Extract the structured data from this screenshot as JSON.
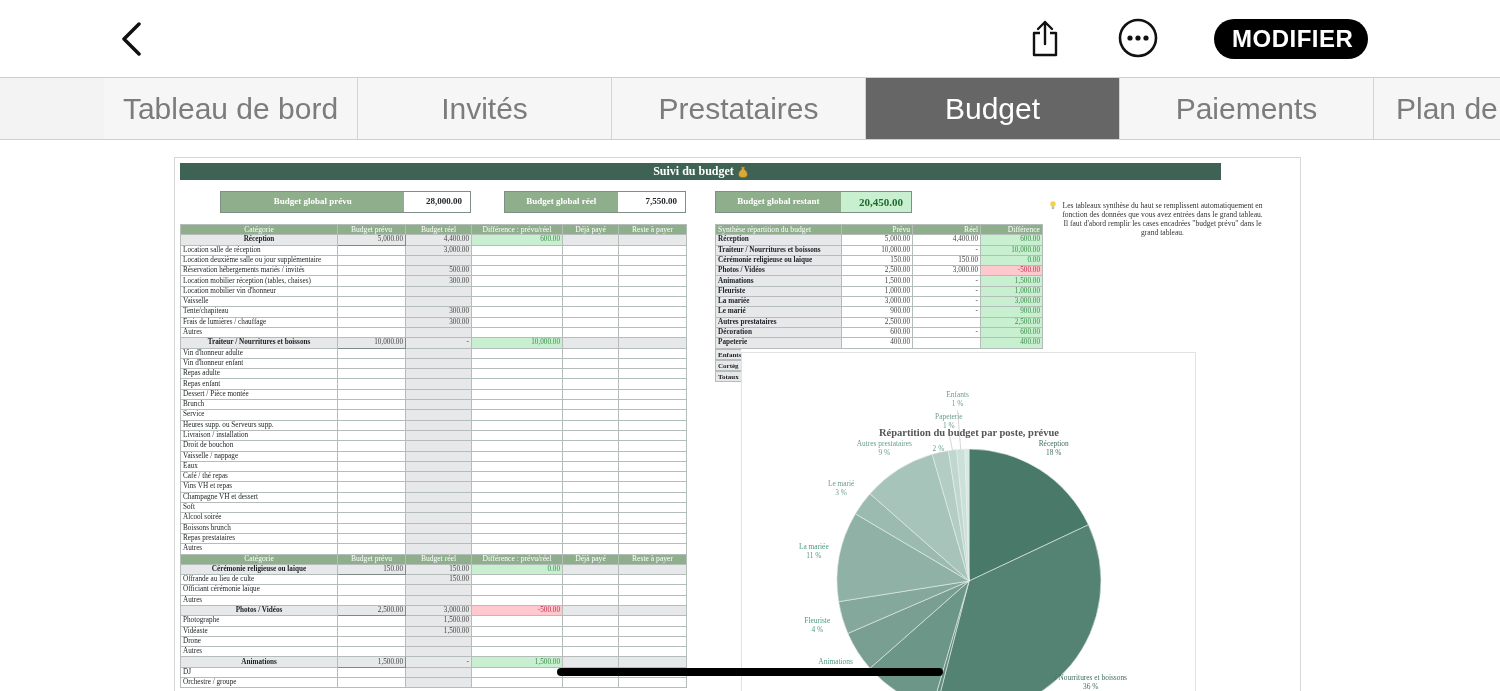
{
  "toolbar": {
    "edit_button": "MODIFIER"
  },
  "tabs": [
    {
      "label": "Tableau de bord",
      "selected": false
    },
    {
      "label": "Invités",
      "selected": false
    },
    {
      "label": "Prestataires",
      "selected": false
    },
    {
      "label": "Budget",
      "selected": true
    },
    {
      "label": "Paiements",
      "selected": false
    },
    {
      "label": "Plan de",
      "selected": false
    }
  ],
  "sheet": {
    "title": "Suivi du budget",
    "left": {
      "totals": [
        {
          "label": "Budget global prévu",
          "value": "28,000.00",
          "highlight": false
        },
        {
          "label": "Budget global réel",
          "value": "7,550.00",
          "highlight": false
        }
      ],
      "rows": [
        {
          "kind": "header",
          "columns": [
            "Catégorie",
            "Budget prévu",
            "Budget réel",
            "Différence : prévu/réel",
            "Déjà payé",
            "Reste à payer"
          ]
        },
        {
          "kind": "category",
          "label": "Réception",
          "planned": "5,000.00",
          "real": "4,400.00",
          "difference": "600.00",
          "negative": false
        },
        {
          "kind": "item",
          "label": "Location salle de réception",
          "real": "3,000.00"
        },
        {
          "kind": "item",
          "label": "Location deuxième salle ou jour supplémentaire"
        },
        {
          "kind": "item",
          "label": "Réservation hébergements mariés / invités",
          "real": "500.00"
        },
        {
          "kind": "item",
          "label": "Location mobilier réception (tables, chaises)",
          "real": "300.00"
        },
        {
          "kind": "item",
          "label": "Location mobilier vin d'honneur"
        },
        {
          "kind": "item",
          "label": "Vaisselle"
        },
        {
          "kind": "item",
          "label": "Tente/chapiteau",
          "real": "300.00"
        },
        {
          "kind": "item",
          "label": "Frais de lumières / chauffage",
          "real": "300.00"
        },
        {
          "kind": "item",
          "label": "Autres"
        },
        {
          "kind": "category",
          "label": "Traiteur / Nourritures et boissons",
          "planned": "10,000.00",
          "real": "-",
          "difference": "10,000.00",
          "negative": false
        },
        {
          "kind": "item",
          "label": "Vin d'honneur adulte"
        },
        {
          "kind": "item",
          "label": "Vin d'honneur enfant"
        },
        {
          "kind": "item",
          "label": "Repas adulte"
        },
        {
          "kind": "item",
          "label": "Repas enfant"
        },
        {
          "kind": "item",
          "label": "Dessert / Pièce montée"
        },
        {
          "kind": "item",
          "label": "Brunch"
        },
        {
          "kind": "item",
          "label": "Service"
        },
        {
          "kind": "item",
          "label": "Heures supp. ou Serveurs supp."
        },
        {
          "kind": "item",
          "label": "Livraison / installation"
        },
        {
          "kind": "item",
          "label": "Droit de bouchon"
        },
        {
          "kind": "item",
          "label": "Vaisselle / nappage"
        },
        {
          "kind": "item",
          "label": "Eaux"
        },
        {
          "kind": "item",
          "label": "Café / thé repas"
        },
        {
          "kind": "item",
          "label": "Vins VH et repas"
        },
        {
          "kind": "item",
          "label": "Champagne VH et dessert"
        },
        {
          "kind": "item",
          "label": "Soft"
        },
        {
          "kind": "item",
          "label": "Alcool soirée"
        },
        {
          "kind": "item",
          "label": "Boissons brunch"
        },
        {
          "kind": "item",
          "label": "Repas prestataires"
        },
        {
          "kind": "item",
          "label": "Autres"
        },
        {
          "kind": "header",
          "columns": [
            "Catégorie",
            "Budget prévu",
            "Budget réel",
            "Différence : prévu/réel",
            "Déjà payé",
            "Reste à payer"
          ]
        },
        {
          "kind": "category",
          "label": "Cérémonie religieuse ou laïque",
          "planned": "150.00",
          "real": "150.00",
          "difference": "0.00",
          "negative": false
        },
        {
          "kind": "item",
          "label": "Offrande au lieu de culte",
          "real": "150.00"
        },
        {
          "kind": "item",
          "label": "Officiant cérémonie laïque"
        },
        {
          "kind": "item",
          "label": "Autres"
        },
        {
          "kind": "category",
          "label": "Photos / Vidéos",
          "planned": "2,500.00",
          "real": "3,000.00",
          "difference": "-500.00",
          "negative": true
        },
        {
          "kind": "item",
          "label": "Photographe",
          "real": "1,500.00"
        },
        {
          "kind": "item",
          "label": "Vidéaste",
          "real": "1,500.00"
        },
        {
          "kind": "item",
          "label": "Drone"
        },
        {
          "kind": "item",
          "label": "Autres"
        },
        {
          "kind": "category",
          "label": "Animations",
          "planned": "1,500.00",
          "real": "-",
          "difference": "1,500.00",
          "negative": false
        },
        {
          "kind": "item",
          "label": "DJ"
        },
        {
          "kind": "item",
          "label": "Orchestre / groupe"
        }
      ]
    },
    "right": {
      "total": {
        "label": "Budget global restant",
        "value": "20,450.00",
        "highlight": true
      },
      "summary_columns": [
        "Synthèse répartition du budget",
        "Prévu",
        "Réel",
        "Différence"
      ],
      "summary_rows": [
        {
          "label": "Réception",
          "planned": "5,000.00",
          "real": "4,400.00",
          "difference": "600.00",
          "negative": false
        },
        {
          "label": "Traiteur / Nourritures et boissons",
          "planned": "10,000.00",
          "real": "-",
          "difference": "10,000.00",
          "negative": false
        },
        {
          "label": "Cérémonie religieuse ou laïque",
          "planned": "150.00",
          "real": "150.00",
          "difference": "0.00",
          "negative": false
        },
        {
          "label": "Photos / Vidéos",
          "planned": "2,500.00",
          "real": "3,000.00",
          "difference": "-500.00",
          "negative": true
        },
        {
          "label": "Animations",
          "planned": "1,500.00",
          "real": "-",
          "difference": "1,500.00",
          "negative": false
        },
        {
          "label": "Fleuriste",
          "planned": "1,000.00",
          "real": "-",
          "difference": "1,000.00",
          "negative": false
        },
        {
          "label": "La mariée",
          "planned": "3,000.00",
          "real": "-",
          "difference": "3,000.00",
          "negative": false
        },
        {
          "label": "Le marié",
          "planned": "900.00",
          "real": "-",
          "difference": "900.00",
          "negative": false
        },
        {
          "label": "Autres prestataires",
          "planned": "2,500.00",
          "difference": "2,500.00",
          "negative": false
        },
        {
          "label": "Décoration",
          "planned": "600.00",
          "real": "-",
          "difference": "600.00",
          "negative": false
        },
        {
          "label": "Papeterie",
          "planned": "400.00",
          "difference": "400.00",
          "negative": false
        }
      ],
      "partial_rows": [
        "Enfants",
        "Cortèg",
        "Totaux"
      ],
      "note": "Les tableaux synthèse du haut se remplissent automatiquement en fonction des données que vous avez entrées dans le grand tableau. Il faut d'abord remplir les cases encadrées \"budget prévu\" dans le grand tableau.",
      "chart": {
        "chart_data": {
          "type": "pie",
          "title": "Répartition du budget par poste, prévue",
          "categories": [
            "Réception",
            "/ Nourritures et boissons",
            null,
            null,
            "Animations",
            "Fleuriste",
            "La mariée",
            "Le marié",
            "Autres prestataires",
            null,
            "Papeterie",
            "Enfants",
            null
          ],
          "values": [
            18,
            36,
            0.5,
            9,
            5,
            4,
            11,
            3,
            9,
            2,
            1,
            1,
            0.5
          ],
          "value_labels": [
            "18 %",
            "36 %",
            null,
            null,
            null,
            "4 %",
            "11 %",
            "3 %",
            "9 %",
            "2 %",
            "1 %",
            "1 %",
            null
          ]
        }
      }
    }
  }
}
